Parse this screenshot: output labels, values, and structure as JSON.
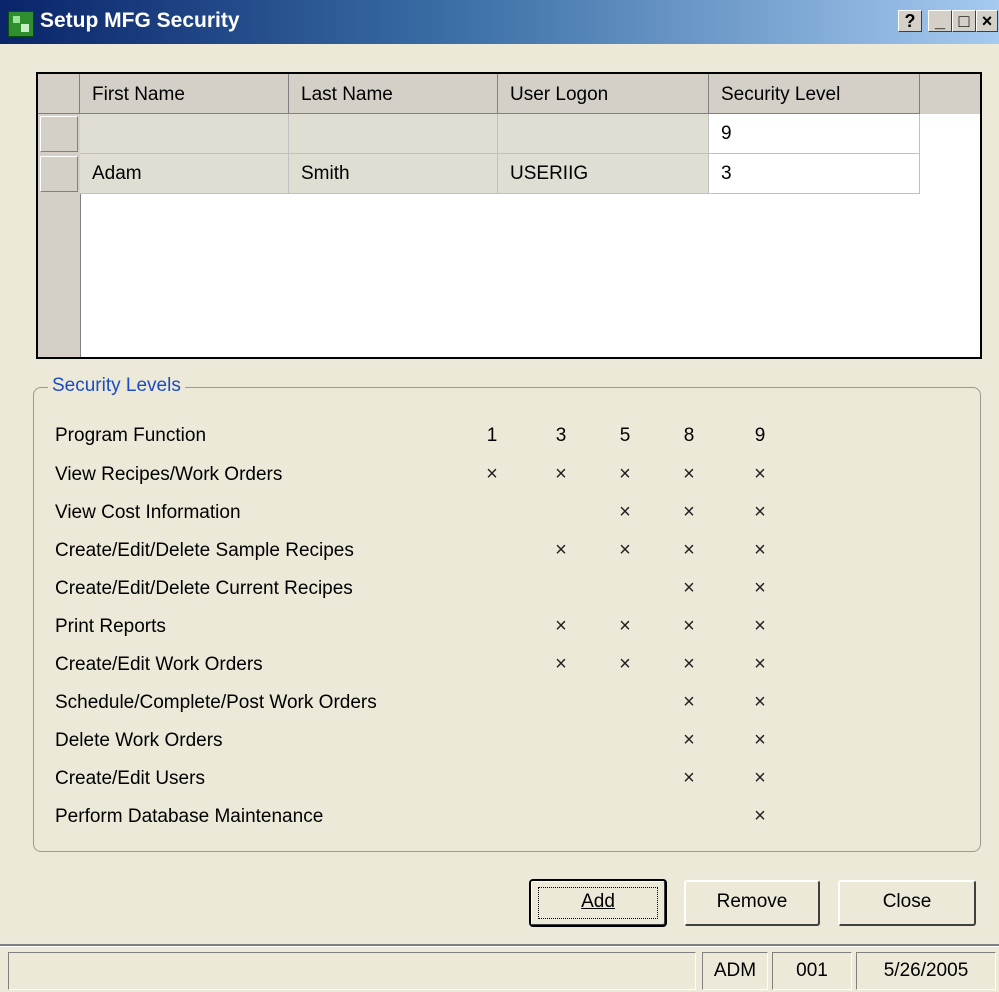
{
  "window": {
    "title": "Setup MFG Security"
  },
  "titlebar_buttons": {
    "help": "?",
    "minimize": "_",
    "maximize": "□",
    "close": "×"
  },
  "grid": {
    "columns": [
      "First Name",
      "Last Name",
      "User Logon",
      "Security Level"
    ],
    "rows": [
      {
        "first": "",
        "last": "",
        "logon": "",
        "level": "9"
      },
      {
        "first": "Adam",
        "last": "Smith",
        "logon": "USERIIG",
        "level": "3"
      }
    ]
  },
  "security": {
    "title": "Security Levels",
    "header": {
      "label": "Program Function",
      "levels": [
        "1",
        "3",
        "5",
        "8",
        "9"
      ]
    },
    "mark": "×",
    "functions": [
      {
        "label": "View Recipes/Work Orders",
        "levels": [
          1,
          1,
          1,
          1,
          1
        ]
      },
      {
        "label": "View Cost Information",
        "levels": [
          0,
          0,
          1,
          1,
          1
        ]
      },
      {
        "label": "Create/Edit/Delete Sample Recipes",
        "levels": [
          0,
          1,
          1,
          1,
          1
        ]
      },
      {
        "label": "Create/Edit/Delete Current Recipes",
        "levels": [
          0,
          0,
          0,
          1,
          1
        ]
      },
      {
        "label": "Print Reports",
        "levels": [
          0,
          1,
          1,
          1,
          1
        ]
      },
      {
        "label": "Create/Edit Work Orders",
        "levels": [
          0,
          1,
          1,
          1,
          1
        ]
      },
      {
        "label": "Schedule/Complete/Post Work Orders",
        "levels": [
          0,
          0,
          0,
          1,
          1
        ]
      },
      {
        "label": "Delete Work Orders",
        "levels": [
          0,
          0,
          0,
          1,
          1
        ]
      },
      {
        "label": "Create/Edit Users",
        "levels": [
          0,
          0,
          0,
          1,
          1
        ]
      },
      {
        "label": "Perform Database Maintenance",
        "levels": [
          0,
          0,
          0,
          0,
          1
        ]
      }
    ]
  },
  "buttons": {
    "add": "Add",
    "remove": "Remove",
    "close": "Close"
  },
  "statusbar": {
    "message": "",
    "user": "ADM",
    "company": "001",
    "date": "5/26/2005"
  }
}
